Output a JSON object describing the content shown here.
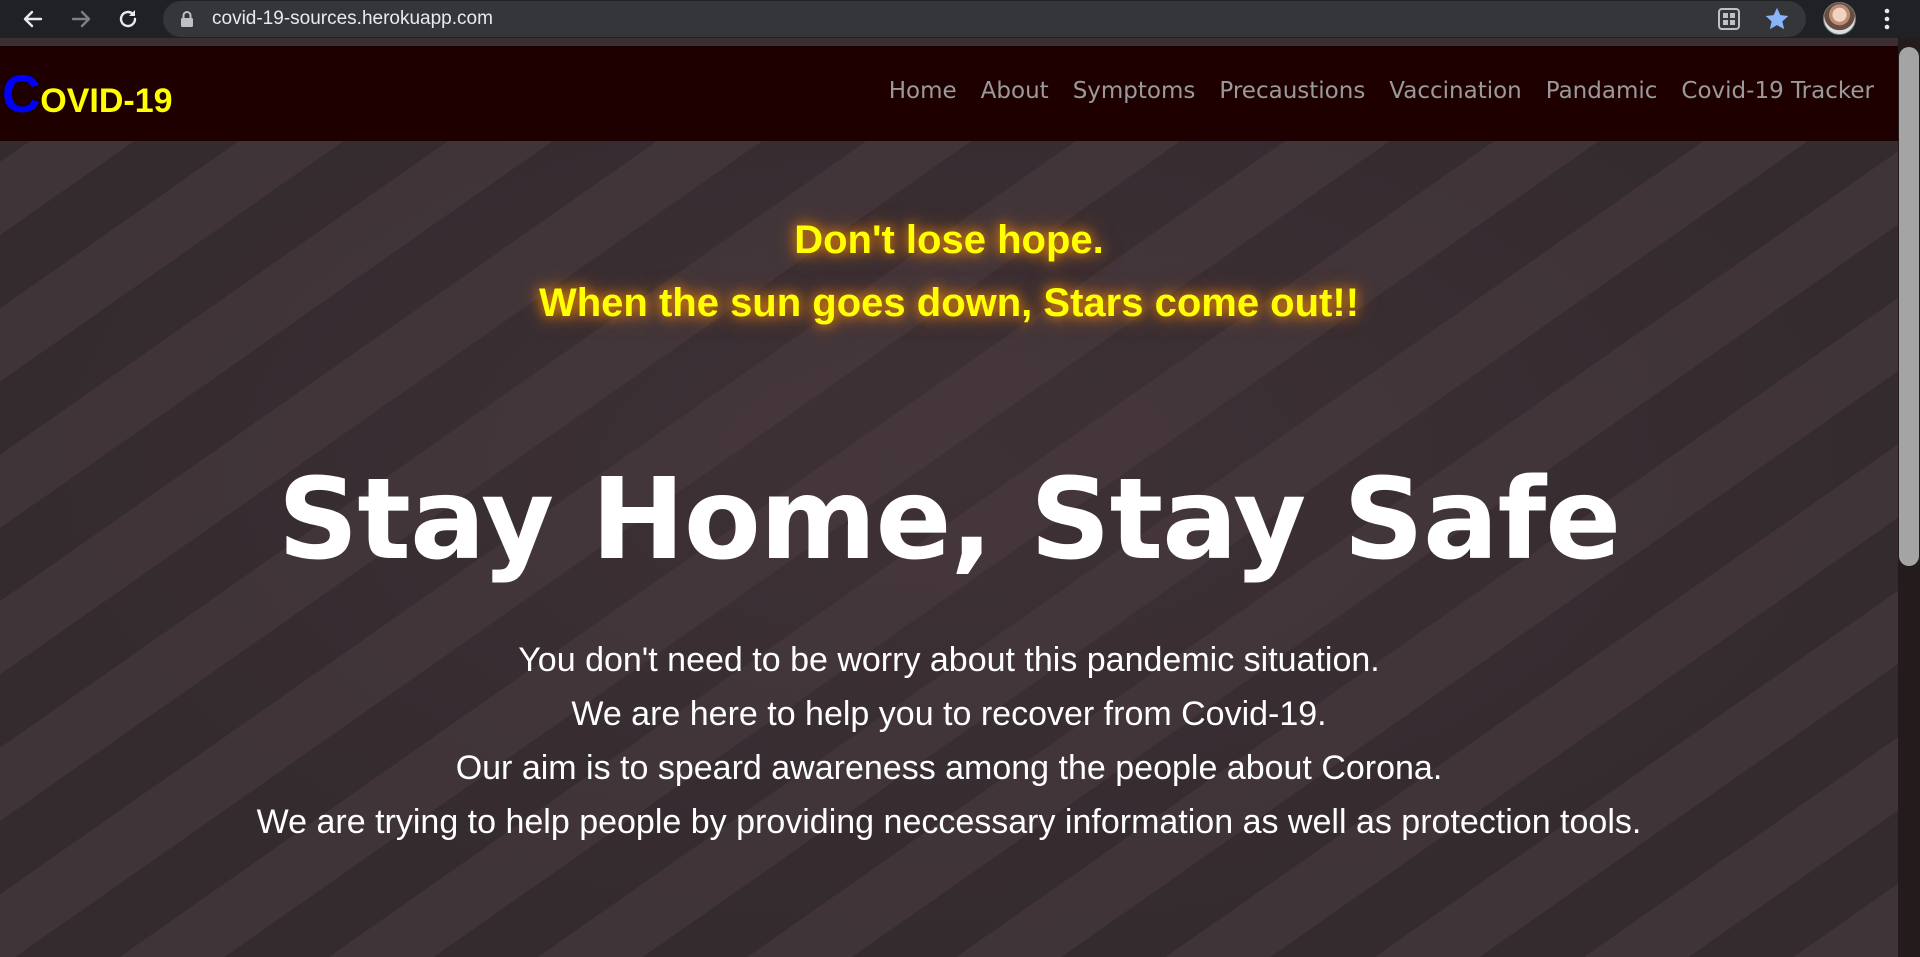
{
  "browser": {
    "url": "covid-19-sources.herokuapp.com",
    "icons": [
      "back-arrow-icon",
      "forward-arrow-icon",
      "reload-icon",
      "lock-icon",
      "extension-icon",
      "bookmark-star-icon",
      "profile-avatar",
      "more-menu-icon"
    ]
  },
  "site": {
    "brand_first": "C",
    "brand_rest": "OVID-19",
    "colors": {
      "nav_bg": "#1f0001",
      "brand_first": "#0000ff",
      "brand_rest": "#ffff00",
      "quote": "#ffff00",
      "menu": "#9a9a9a"
    },
    "menu": [
      {
        "label": "Home"
      },
      {
        "label": "About"
      },
      {
        "label": "Symptoms"
      },
      {
        "label": "Precaustions"
      },
      {
        "label": "Vaccination"
      },
      {
        "label": "Pandamic"
      },
      {
        "label": "Covid-19 Tracker"
      }
    ]
  },
  "hero": {
    "quote_line_1": "Don't lose hope.",
    "quote_line_2": "When the sun goes down, Stars come out!!",
    "headline": "Stay Home, Stay Safe",
    "paragraphs": [
      "You don't need to be worry about this pandemic situation.",
      "We are here to help you to recover from Covid-19.",
      "Our aim is to speard awareness among the people about Corona.",
      "We are trying to help people by providing neccessary information as well as protection tools."
    ]
  }
}
